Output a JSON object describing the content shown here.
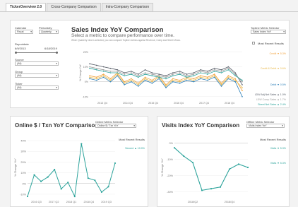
{
  "tabs": [
    {
      "label": "TickerOverview 2.0",
      "active": true
    },
    {
      "label": "Cross-Company Comparison",
      "active": false
    },
    {
      "label": "Intra-Company Comparison",
      "active": false
    }
  ],
  "filters": {
    "calendar_label": "Calendar",
    "calendar_value": "Fiscal",
    "periodicity_label": "Periodicity",
    "periodicity_value": "Quarterly",
    "reportdate_label": "Reportdate",
    "report_start": "6/9/2013",
    "report_end": "6/18/2019",
    "source_label": "Source",
    "source_value": "(All)",
    "group_label": "Group",
    "group_value": "(All)",
    "ticker_label": "Ticker",
    "ticker_value": "(All)"
  },
  "sales_chart": {
    "title": "Sales Index YoY Comparison",
    "subtitle": "Select a metric to compare performance over time.",
    "note": "When Quarterly view is selected, you can compare Topline metrics against Revenue, Comp and Street Views.",
    "selector_label": "Topline Metric Selector",
    "selector_value": "Sales Index YoY",
    "most_recent_label": "Most Recent Results",
    "ylabel": "% Change YoY",
    "colors": {
      "credit": "#f2a23b",
      "credit_debit": "#e8b84a",
      "debit": "#2b7fb8",
      "gray": "#9a9a9a",
      "dark": "#555b66",
      "teal": "#2ca39b"
    }
  },
  "sales_legend": [
    {
      "text": "Credit ▼ 5.3%",
      "color": "#f2a23b"
    },
    {
      "text": "Credit & Debit ▼ 0.6%",
      "color": "#e8b84a"
    },
    {
      "text": "Debit ▼ 0.5%",
      "color": "#2b7fb8"
    },
    {
      "text": "LDW Adj Net Sales ▲ 1.0%",
      "color": "#555b66"
    },
    {
      "text": "LDW Comp Sales ▲ 1.7%",
      "color": "#9a9a9a"
    },
    {
      "text": "Street Net Sales ▲ 2.4%",
      "color": "#2ca39b"
    }
  ],
  "online_chart": {
    "title": "Online $ / Txn YoY Comparison",
    "selector_label": "Online Metric Selector",
    "selector_value": "Online $ / Txn YoY",
    "most_recent_label": "Most Recent Results",
    "legend_text": "Second ▲ 10.0%",
    "ylabel": "% Change YoY",
    "color": "#2ca39b"
  },
  "visits_chart": {
    "title": "Visits Index YoY Comparison",
    "selector_label": "Offline Metric Selector",
    "selector_value": "Visits Index YoY",
    "most_recent_label": "Most Recent Results",
    "legend1": "Visits ▼ 5.3%",
    "legend2": "Visits ▼ 5.3%",
    "ylabel": "% Change YoY",
    "color": "#2ca39b"
  },
  "chart_data": [
    {
      "type": "line",
      "title": "Sales Index YoY Comparison",
      "ylabel": "% Change YoY",
      "x": [
        "2013 Q4",
        "2014 Q1",
        "2014 Q2",
        "2014 Q3",
        "2014 Q4",
        "2015 Q1",
        "2015 Q2",
        "2015 Q3",
        "2015 Q4",
        "2016 Q1",
        "2016 Q2",
        "2016 Q3",
        "2016 Q4",
        "2017 Q1",
        "2017 Q2",
        "2017 Q3",
        "2017 Q4",
        "2018 Q1",
        "2018 Q2",
        "2018 Q3",
        "2018 Q4",
        "2019 Q1",
        "2019 Q2"
      ],
      "xticks": [
        "2013 Q4",
        "2014 Q4",
        "2015 Q4",
        "2016 Q4",
        "2017 Q4",
        "2018 Q4"
      ],
      "yticks": [
        "-10%",
        "0%",
        "10%",
        "20%"
      ],
      "ylim": [
        -12,
        24
      ],
      "series": [
        {
          "name": "Credit",
          "color": "#f2a23b",
          "values": [
            4,
            3,
            5,
            2,
            6,
            0,
            2,
            -1,
            3,
            1,
            4,
            -2,
            2,
            1,
            3,
            2,
            4,
            3,
            5,
            -1,
            4,
            2,
            -6
          ]
        },
        {
          "name": "Credit & Debit",
          "color": "#e8b84a",
          "values": [
            3,
            2,
            4,
            1,
            5,
            -1,
            1,
            -2,
            2,
            0,
            3,
            -3,
            1,
            0,
            2,
            1,
            3,
            2,
            4,
            -2,
            3,
            1,
            -4
          ]
        },
        {
          "name": "Debit",
          "color": "#2b7fb8",
          "values": [
            2,
            1,
            3,
            0,
            4,
            -2,
            0,
            -3,
            1,
            -1,
            2,
            -4,
            0,
            -1,
            1,
            0,
            2,
            1,
            3,
            -3,
            2,
            0,
            -10
          ]
        },
        {
          "name": "LDW Adj Net Sales",
          "color": "#555b66",
          "values": [
            12,
            11,
            10,
            9,
            8,
            6,
            7,
            5,
            8,
            6,
            5,
            4,
            6,
            7,
            5,
            6,
            8,
            7,
            9,
            8,
            10,
            6,
            -2
          ]
        },
        {
          "name": "LDW Comp Sales",
          "color": "#9a9a9a",
          "values": [
            10,
            9,
            8,
            7,
            7,
            5,
            6,
            4,
            6,
            5,
            4,
            3,
            5,
            6,
            4,
            5,
            7,
            6,
            8,
            7,
            9,
            5,
            0
          ]
        },
        {
          "name": "Street Net Sales",
          "color": "#2ca39b",
          "values": [
            9,
            8,
            7,
            6,
            6,
            4,
            5,
            3,
            5,
            4,
            3,
            2,
            4,
            5,
            3,
            4,
            6,
            5,
            7,
            6,
            8,
            4,
            1
          ]
        }
      ]
    },
    {
      "type": "line",
      "title": "Online $ / Txn YoY Comparison",
      "ylabel": "% Change YoY",
      "x": [
        "2016 Q1",
        "2016 Q2",
        "2016 Q3",
        "2016 Q4",
        "2017 Q1",
        "2017 Q2",
        "2017 Q3",
        "2017 Q4",
        "2018 Q1",
        "2018 Q2",
        "2018 Q3",
        "2018 Q4",
        "2019 Q1",
        "2019 Q2"
      ],
      "xticks": [
        "2016 Q3",
        "2017 Q2",
        "2018 Q1",
        "2018 Q4",
        "2019 Q3"
      ],
      "yticks": [
        "-10%",
        "0%",
        "10%",
        "20%",
        "30%",
        "40%"
      ],
      "ylim": [
        -14,
        44
      ],
      "series": [
        {
          "name": "Second",
          "color": "#2ca39b",
          "values": [
            -12,
            8,
            2,
            6,
            13,
            -5,
            1,
            -12,
            37,
            5,
            3,
            -8,
            -3,
            19
          ]
        }
      ]
    },
    {
      "type": "line",
      "title": "Visits Index YoY Comparison",
      "ylabel": "% Change YoY",
      "x": [
        "2017 Q1",
        "2017 Q2",
        "2017 Q3",
        "2017 Q4",
        "2018 Q1",
        "2018 Q2",
        "2018 Q3",
        "2018 Q4",
        "2019 Q1"
      ],
      "xticks": [
        "2018/Q2",
        "2018/Q4"
      ],
      "yticks": [
        "-30%",
        "-20%",
        "-10%",
        "0%"
      ],
      "ylim": [
        -34,
        4
      ],
      "series": [
        {
          "name": "Visits",
          "color": "#2ca39b",
          "values": [
            -3,
            -8,
            -12,
            -29,
            -28,
            -27,
            -16,
            -13,
            -15
          ]
        }
      ]
    }
  ]
}
